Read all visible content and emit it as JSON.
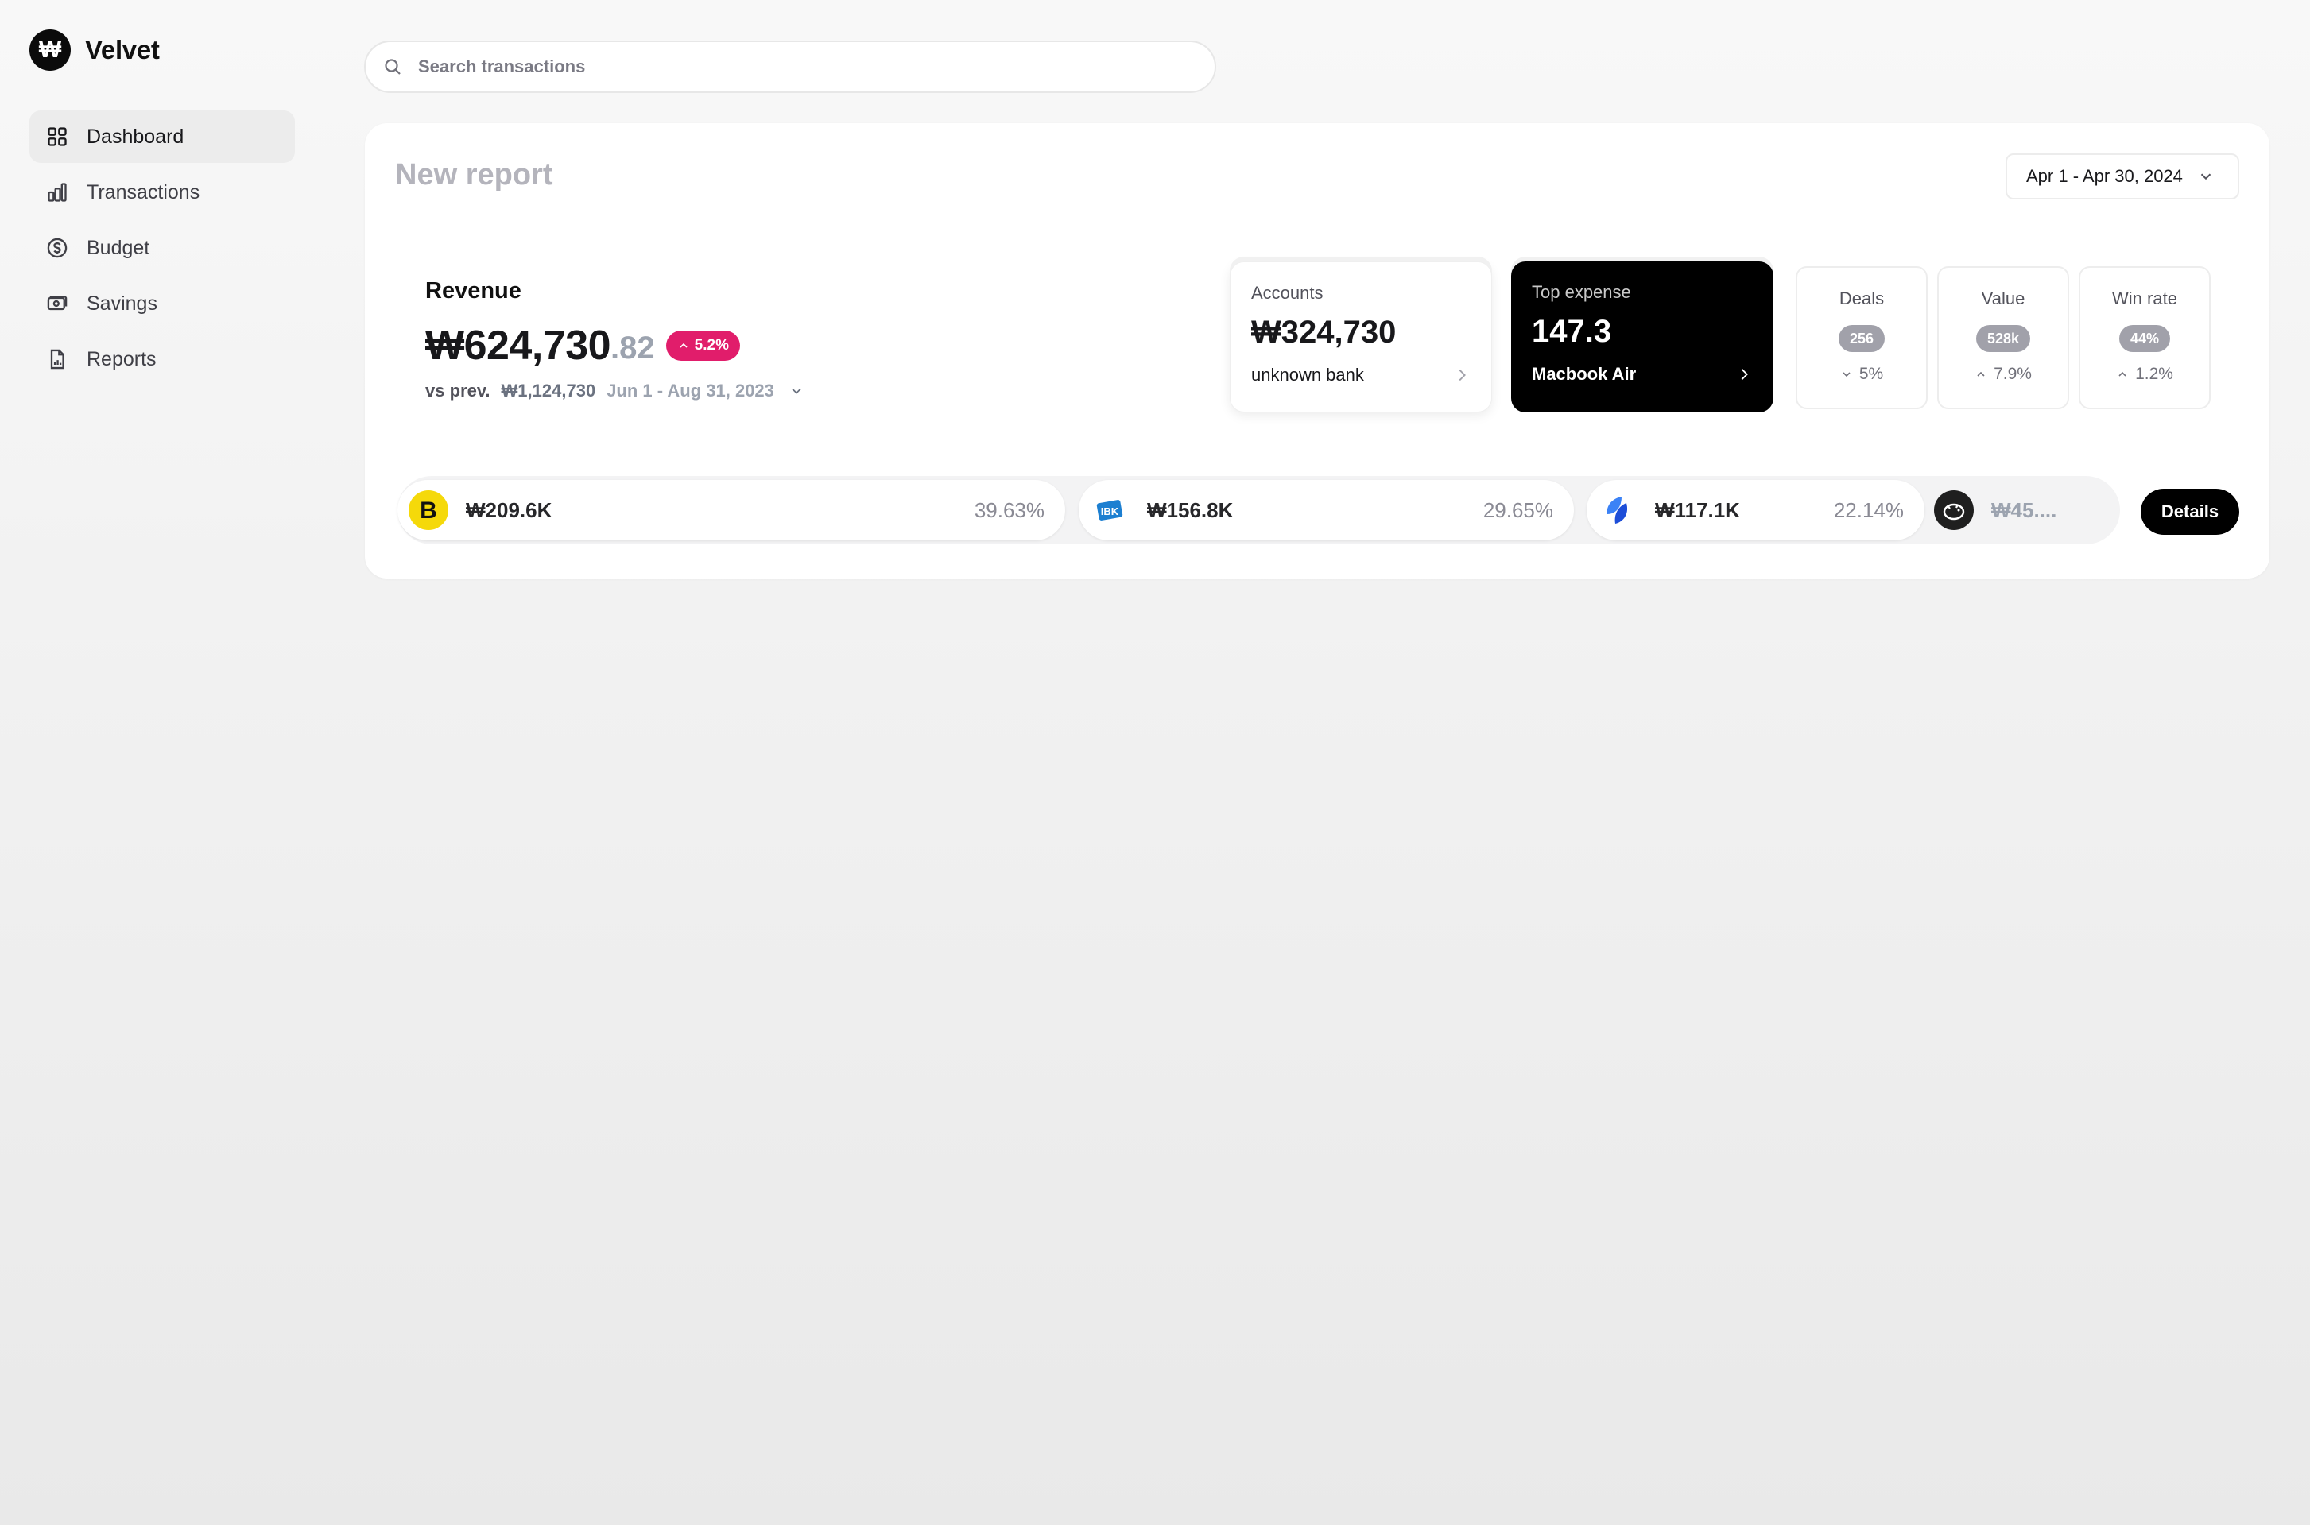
{
  "brand": {
    "logo_glyph": "₩",
    "name": "Velvet"
  },
  "sidebar": {
    "items": [
      {
        "label": "Dashboard",
        "icon": "grid-icon",
        "active": true
      },
      {
        "label": "Transactions",
        "icon": "bar-chart-icon"
      },
      {
        "label": "Budget",
        "icon": "dollar-circle-icon"
      },
      {
        "label": "Savings",
        "icon": "wallet-icon"
      },
      {
        "label": "Reports",
        "icon": "document-chart-icon"
      }
    ]
  },
  "search": {
    "placeholder": "Search transactions",
    "value": ""
  },
  "report": {
    "title": "New report",
    "date_range": "Apr 1 - Apr 30, 2024",
    "revenue": {
      "label": "Revenue",
      "amount": "₩624,730",
      "decimals": ".82",
      "change": "5.2%",
      "vs_label": "vs prev.",
      "prev_amount": "₩1,124,730",
      "prev_range": "Jun 1 - Aug 31, 2023"
    },
    "accounts_card": {
      "label": "Accounts",
      "value": "₩324,730",
      "footer": "unknown bank"
    },
    "top_expense_card": {
      "label": "Top expense",
      "value": "147.3",
      "footer": "Macbook Air"
    },
    "stats": [
      {
        "label": "Deals",
        "badge": "256",
        "change": "5%",
        "direction": "down"
      },
      {
        "label": "Value",
        "badge": "528k",
        "change": "7.9%",
        "direction": "up"
      },
      {
        "label": "Win rate",
        "badge": "44%",
        "change": "1.2%",
        "direction": "up"
      }
    ],
    "sources": [
      {
        "amount": "₩209.6K",
        "percent": "39.63%",
        "logo": "b-logo",
        "color": "#f5d90a"
      },
      {
        "amount": "₩156.8K",
        "percent": "29.65%",
        "logo": "ibk-logo",
        "color": "#1c7fd1"
      },
      {
        "amount": "₩117.1K",
        "percent": "22.14%",
        "logo": "blue-wing-logo",
        "color": "#2563eb"
      },
      {
        "amount": "₩45....",
        "logo": "piggy-bank-logo",
        "color": "#1f1f1f"
      }
    ],
    "details_label": "Details"
  },
  "colors": {
    "accent_pink": "#e11d6b",
    "dark": "#000000",
    "muted_badge": "#a1a1aa"
  }
}
